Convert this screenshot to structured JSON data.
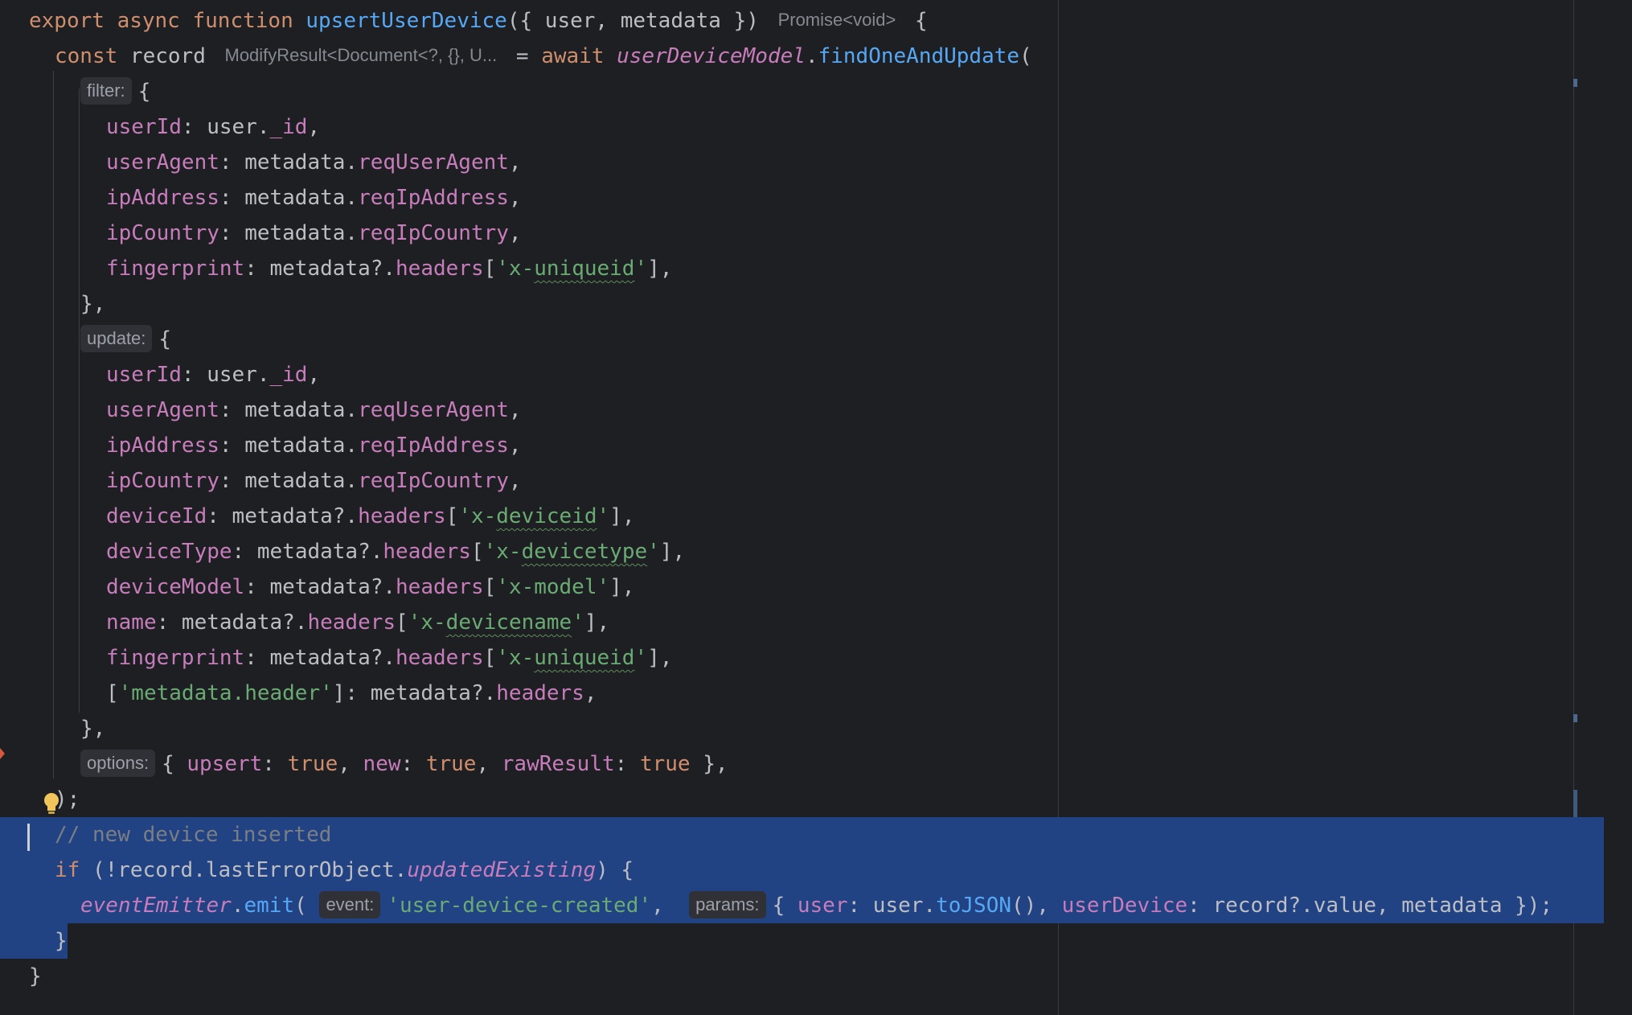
{
  "editor": {
    "lines": [
      [
        [
          "kw",
          "export async function "
        ],
        [
          "fn",
          "upsertUserDevice"
        ],
        [
          "id",
          "({ user, metadata }) "
        ],
        [
          "typehint",
          "Promise<void>"
        ],
        [
          "id",
          " {"
        ]
      ],
      [
        [
          "kw",
          "const "
        ],
        [
          "id",
          "record "
        ],
        [
          "typehint",
          "ModifyResult<Document<?, {}, U..."
        ],
        [
          "id",
          " = "
        ],
        [
          "kw",
          "await "
        ],
        [
          "glob",
          "userDeviceModel"
        ],
        [
          "id",
          "."
        ],
        [
          "fn",
          "findOneAndUpdate"
        ],
        [
          "id",
          "("
        ]
      ],
      [
        [
          "hint",
          "filter:"
        ],
        [
          "id",
          "{"
        ]
      ],
      [
        [
          "prop",
          "userId"
        ],
        [
          "id",
          ": user."
        ],
        [
          "prop",
          "_id"
        ],
        [
          "id",
          ","
        ]
      ],
      [
        [
          "prop",
          "userAgent"
        ],
        [
          "id",
          ": metadata."
        ],
        [
          "prop",
          "reqUserAgent"
        ],
        [
          "id",
          ","
        ]
      ],
      [
        [
          "prop",
          "ipAddress"
        ],
        [
          "id",
          ": metadata."
        ],
        [
          "prop",
          "reqIpAddress"
        ],
        [
          "id",
          ","
        ]
      ],
      [
        [
          "prop",
          "ipCountry"
        ],
        [
          "id",
          ": metadata."
        ],
        [
          "prop",
          "reqIpCountry"
        ],
        [
          "id",
          ","
        ]
      ],
      [
        [
          "prop",
          "fingerprint"
        ],
        [
          "id",
          ": metadata?."
        ],
        [
          "prop",
          "headers"
        ],
        [
          "id",
          "["
        ],
        [
          "str",
          "'x-"
        ],
        [
          "strsq",
          "uniqueid"
        ],
        [
          "str",
          "'"
        ],
        [
          "id",
          "],"
        ]
      ],
      [
        [
          "id",
          "},"
        ]
      ],
      [
        [
          "hint",
          "update:"
        ],
        [
          "id",
          "{"
        ]
      ],
      [
        [
          "prop",
          "userId"
        ],
        [
          "id",
          ": user."
        ],
        [
          "prop",
          "_id"
        ],
        [
          "id",
          ","
        ]
      ],
      [
        [
          "prop",
          "userAgent"
        ],
        [
          "id",
          ": metadata."
        ],
        [
          "prop",
          "reqUserAgent"
        ],
        [
          "id",
          ","
        ]
      ],
      [
        [
          "prop",
          "ipAddress"
        ],
        [
          "id",
          ": metadata."
        ],
        [
          "prop",
          "reqIpAddress"
        ],
        [
          "id",
          ","
        ]
      ],
      [
        [
          "prop",
          "ipCountry"
        ],
        [
          "id",
          ": metadata."
        ],
        [
          "prop",
          "reqIpCountry"
        ],
        [
          "id",
          ","
        ]
      ],
      [
        [
          "prop",
          "deviceId"
        ],
        [
          "id",
          ": metadata?."
        ],
        [
          "prop",
          "headers"
        ],
        [
          "id",
          "["
        ],
        [
          "str",
          "'x-"
        ],
        [
          "strsq",
          "deviceid"
        ],
        [
          "str",
          "'"
        ],
        [
          "id",
          "],"
        ]
      ],
      [
        [
          "prop",
          "deviceType"
        ],
        [
          "id",
          ": metadata?."
        ],
        [
          "prop",
          "headers"
        ],
        [
          "id",
          "["
        ],
        [
          "str",
          "'x-"
        ],
        [
          "strsq",
          "devicetype"
        ],
        [
          "str",
          "'"
        ],
        [
          "id",
          "],"
        ]
      ],
      [
        [
          "prop",
          "deviceModel"
        ],
        [
          "id",
          ": metadata?."
        ],
        [
          "prop",
          "headers"
        ],
        [
          "id",
          "["
        ],
        [
          "str",
          "'x-model'"
        ],
        [
          "id",
          "],"
        ]
      ],
      [
        [
          "prop",
          "name"
        ],
        [
          "id",
          ": metadata?."
        ],
        [
          "prop",
          "headers"
        ],
        [
          "id",
          "["
        ],
        [
          "str",
          "'x-"
        ],
        [
          "strsq",
          "devicename"
        ],
        [
          "str",
          "'"
        ],
        [
          "id",
          "],"
        ]
      ],
      [
        [
          "prop",
          "fingerprint"
        ],
        [
          "id",
          ": metadata?."
        ],
        [
          "prop",
          "headers"
        ],
        [
          "id",
          "["
        ],
        [
          "str",
          "'x-"
        ],
        [
          "strsq",
          "uniqueid"
        ],
        [
          "str",
          "'"
        ],
        [
          "id",
          "],"
        ]
      ],
      [
        [
          "id",
          "["
        ],
        [
          "str",
          "'metadata.header'"
        ],
        [
          "id",
          "]: metadata?."
        ],
        [
          "prop",
          "headers"
        ],
        [
          "id",
          ","
        ]
      ],
      [
        [
          "id",
          "},"
        ]
      ],
      [
        [
          "hint",
          "options:"
        ],
        [
          "id",
          "{ "
        ],
        [
          "prop",
          "upsert"
        ],
        [
          "id",
          ": "
        ],
        [
          "kw",
          "true"
        ],
        [
          "id",
          ", "
        ],
        [
          "prop",
          "new"
        ],
        [
          "id",
          ": "
        ],
        [
          "kw",
          "true"
        ],
        [
          "id",
          ", "
        ],
        [
          "prop",
          "rawResult"
        ],
        [
          "id",
          ": "
        ],
        [
          "kw",
          "true"
        ],
        [
          "id",
          " },"
        ]
      ],
      [
        [
          "id",
          ");"
        ]
      ],
      [
        [
          "cmt",
          "// new device inserted"
        ]
      ],
      [
        [
          "kw",
          "if "
        ],
        [
          "id",
          "(!record.lastErrorObject."
        ],
        [
          "propi",
          "updatedExisting"
        ],
        [
          "id",
          ") {"
        ]
      ],
      [
        [
          "glob",
          "eventEmitter"
        ],
        [
          "id",
          "."
        ],
        [
          "fn",
          "emit"
        ],
        [
          "id",
          "( "
        ],
        [
          "hint",
          "event:"
        ],
        [
          "str",
          "'user-device-created'"
        ],
        [
          "id",
          ",  "
        ],
        [
          "hint",
          "params:"
        ],
        [
          "id",
          "{ "
        ],
        [
          "prop",
          "user"
        ],
        [
          "id",
          ": user."
        ],
        [
          "fn",
          "toJSON"
        ],
        [
          "id",
          "(), "
        ],
        [
          "prop",
          "userDevice"
        ],
        [
          "id",
          ": record?.value, metadata });"
        ]
      ],
      [
        [
          "id",
          "}"
        ]
      ],
      [
        [
          "id",
          "}"
        ]
      ]
    ]
  }
}
